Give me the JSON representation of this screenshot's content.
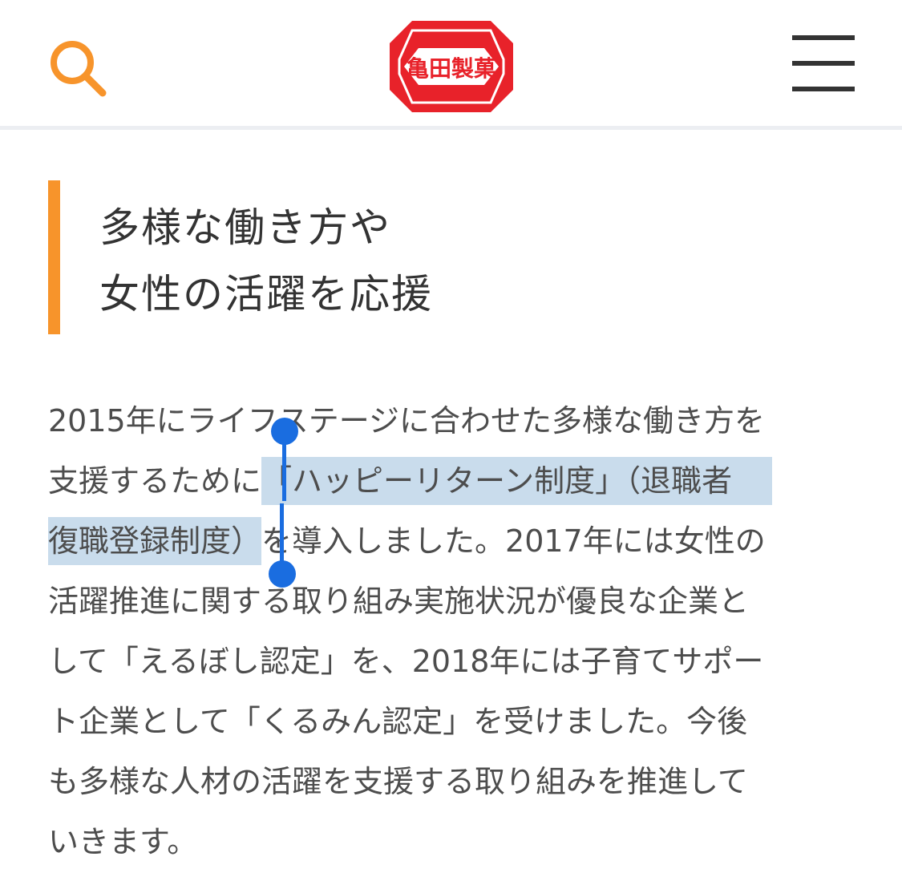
{
  "header": {
    "search_icon": "search-icon",
    "logo_text": "亀田製菓",
    "menu_icon": "hamburger-menu-icon",
    "colors": {
      "accent": "#f7942b",
      "logo_red": "#e8222a"
    }
  },
  "section": {
    "heading_lines": [
      "多様な働き方や",
      "女性の活躍を応援"
    ]
  },
  "paragraph": {
    "line1": "2015年にライフステージに合わせた多様な働き方を",
    "line2_plain": "支援するために",
    "line2_selected": "「ハッピーリターン制度」（退職者",
    "line3_selected": "復職登録制度）",
    "line3_plain": "を導入しました。2017年には女性の",
    "line4": "活躍推進に関する取り組み実施状況が優良な企業と",
    "line5": "して「えるぼし認定」を、2018年には子育てサポー",
    "line6": "ト企業として「くるみん認定」を受けました。今後",
    "line7": "も多様な人材の活躍を支援する取り組みを推進して",
    "line8": "いきます。",
    "selection_color": "#c9dcec",
    "selection_handle_color": "#1a6de0"
  }
}
